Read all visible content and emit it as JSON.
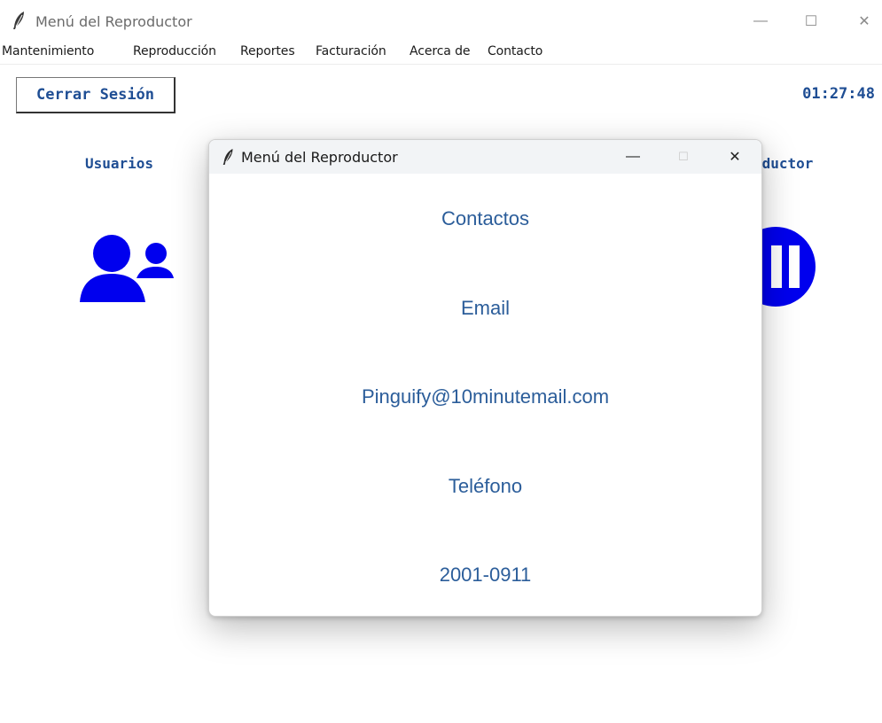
{
  "window": {
    "title": "Menú del Reproductor",
    "minimize_glyph": "—",
    "maximize_glyph": "☐",
    "close_glyph": "✕"
  },
  "menubar": {
    "items": [
      "Mantenimiento",
      "Reproducción",
      "Reportes",
      "Facturación",
      "Acerca de",
      "Contacto"
    ]
  },
  "toolbar": {
    "logout_label": "Cerrar Sesión",
    "clock": "01:27:48"
  },
  "sections": {
    "users_label": "Usuarios",
    "player_label_visible": "oductor"
  },
  "dialog": {
    "title": "Menú del Reproductor",
    "minimize_glyph": "—",
    "maximize_glyph": "☐",
    "close_glyph": "✕",
    "heading": "Contactos",
    "email_label": "Email",
    "email_value": "Pinguify@10minutemail.com",
    "phone_label": "Teléfono",
    "phone_value": "2001-0911"
  },
  "colors": {
    "accent_text": "#1f4e94",
    "icon_blue": "#0000ee",
    "dialog_text": "#2b5d9a"
  },
  "icons": [
    "feather-icon",
    "users-icon",
    "player-icon",
    "minimize-icon",
    "maximize-icon",
    "close-icon"
  ]
}
